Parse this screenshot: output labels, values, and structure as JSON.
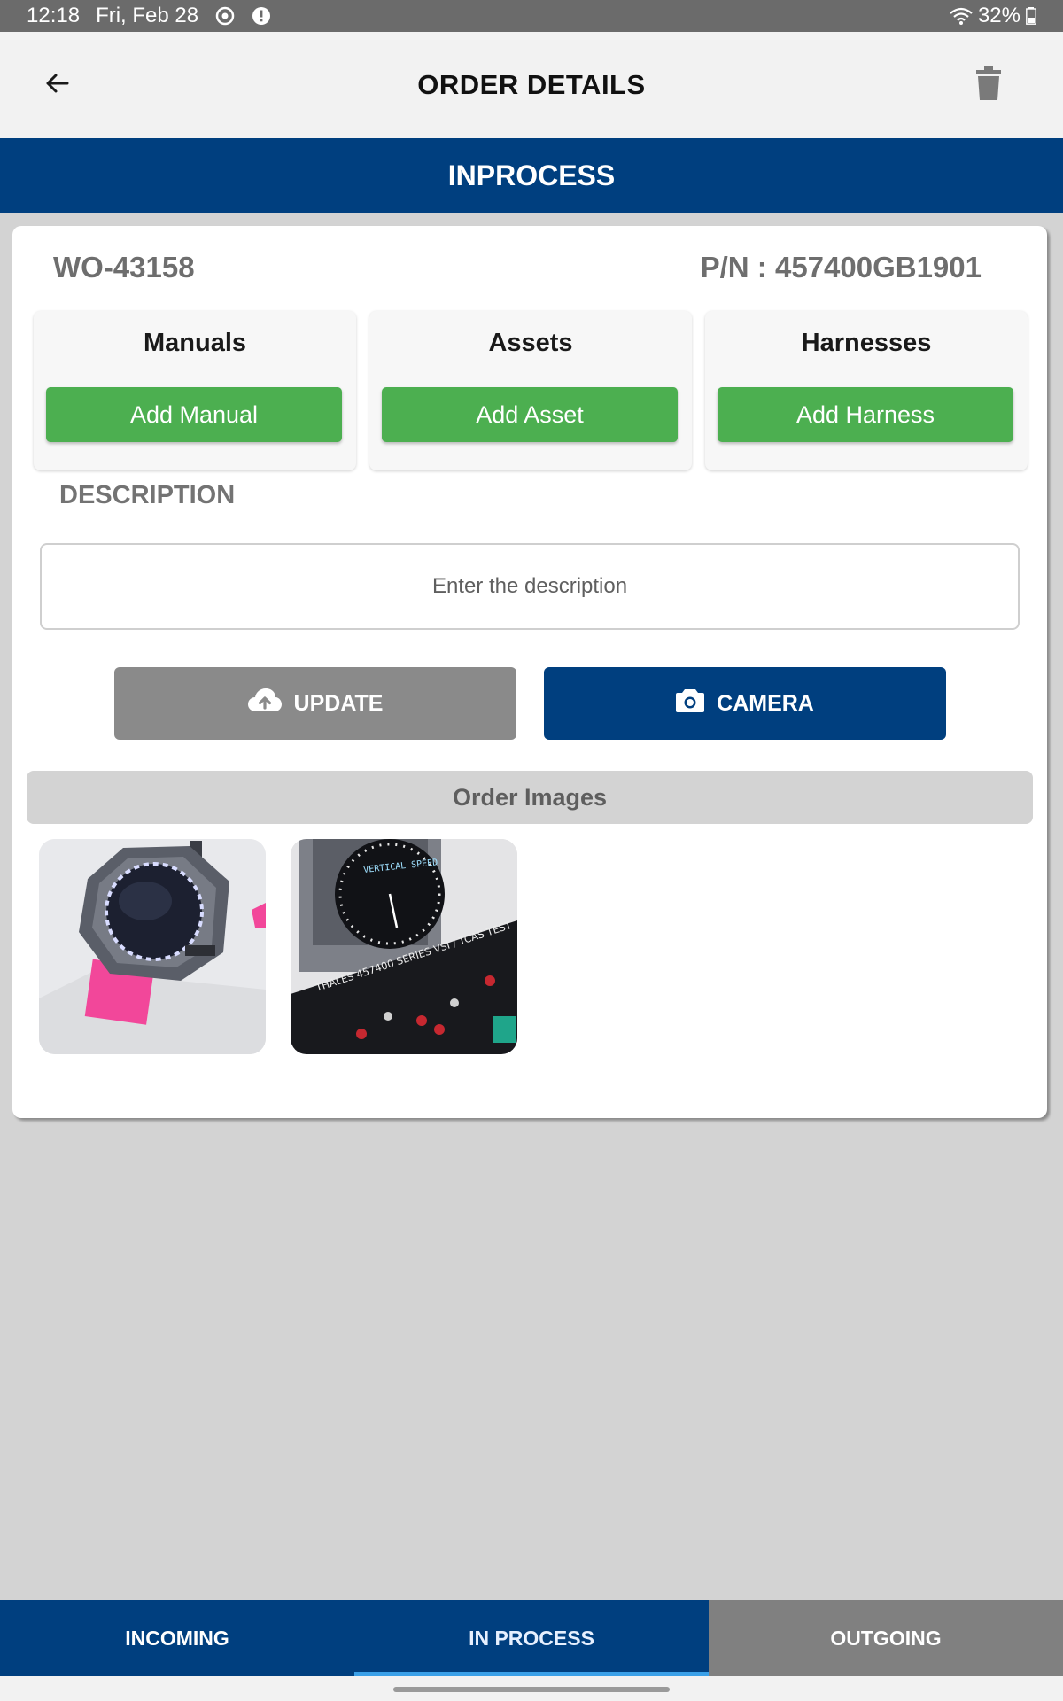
{
  "status_bar": {
    "time": "12:18",
    "date": "Fri, Feb 28",
    "battery": "32%",
    "icons": [
      "sync-icon",
      "alert-icon",
      "wifi-icon",
      "battery-icon"
    ]
  },
  "header": {
    "title": "ORDER DETAILS",
    "back_icon": "arrow-left-icon",
    "delete_icon": "trash-icon"
  },
  "status_banner": {
    "label": "INPROCESS"
  },
  "order": {
    "work_order": "WO-43158",
    "part_number": "P/N : 457400GB1901"
  },
  "sections": [
    {
      "title": "Manuals",
      "button_label": "Add Manual"
    },
    {
      "title": "Assets",
      "button_label": "Add Asset"
    },
    {
      "title": "Harnesses",
      "button_label": "Add Harness"
    }
  ],
  "description": {
    "label": "DESCRIPTION",
    "value": "",
    "placeholder": "Enter the description"
  },
  "actions": {
    "update_label": "UPDATE",
    "update_icon": "cloud-upload-icon",
    "camera_label": "CAMERA",
    "camera_icon": "camera-icon"
  },
  "images": {
    "header": "Order Images",
    "items": [
      {
        "name": "vsi-instrument-photo"
      },
      {
        "name": "vsi-tester-photo",
        "panel_text": "THALES 457400 SERIES VSI / TCAS TEST",
        "dial_text": "VERTICAL SPEED"
      }
    ]
  },
  "bottom_nav": {
    "tabs": [
      {
        "label": "INCOMING",
        "active": false
      },
      {
        "label": "IN PROCESS",
        "active": true
      },
      {
        "label": "OUTGOING",
        "active": false
      }
    ]
  },
  "colors": {
    "primary_blue": "#003f7f",
    "add_green": "#4caf50",
    "update_gray": "#8a8a8a",
    "active_indicator": "#3aa0e8"
  }
}
